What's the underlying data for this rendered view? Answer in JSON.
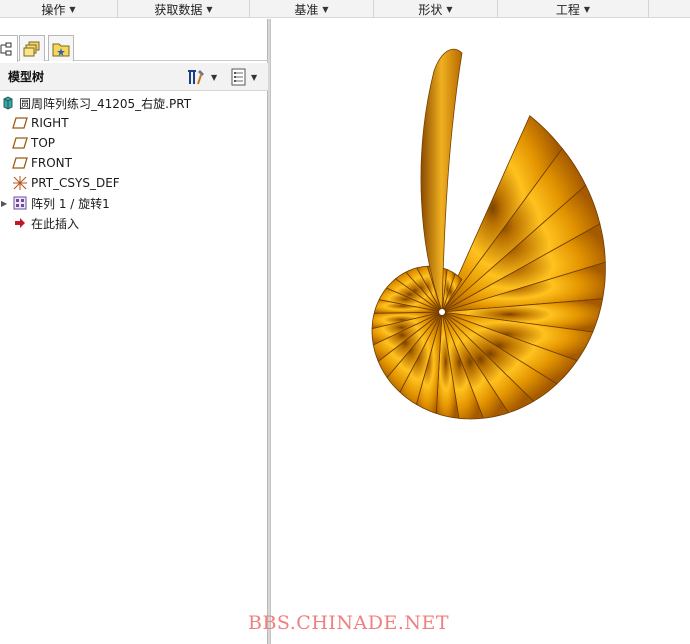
{
  "menubar": {
    "items": [
      {
        "label": "操作"
      },
      {
        "label": "获取数据"
      },
      {
        "label": "基准"
      },
      {
        "label": "形状"
      },
      {
        "label": "工程"
      }
    ]
  },
  "model_tree": {
    "title": "模型树",
    "items": [
      {
        "label": "圆周阵列练习_41205_右旋.PRT",
        "icon": "part-icon"
      },
      {
        "label": "RIGHT",
        "icon": "datum-plane-icon"
      },
      {
        "label": "TOP",
        "icon": "datum-plane-icon"
      },
      {
        "label": "FRONT",
        "icon": "datum-plane-icon"
      },
      {
        "label": "PRT_CSYS_DEF",
        "icon": "csys-icon"
      },
      {
        "label": "阵列 1 / 旋转1",
        "icon": "pattern-icon"
      },
      {
        "label": "在此插入",
        "icon": "insert-here-arrow-icon"
      }
    ]
  },
  "viewport": {
    "model": "spiral-shell-revolve-pattern",
    "shell_color": "#e8a20a"
  },
  "watermark": {
    "text": "BBS.CHINADE.NET"
  }
}
